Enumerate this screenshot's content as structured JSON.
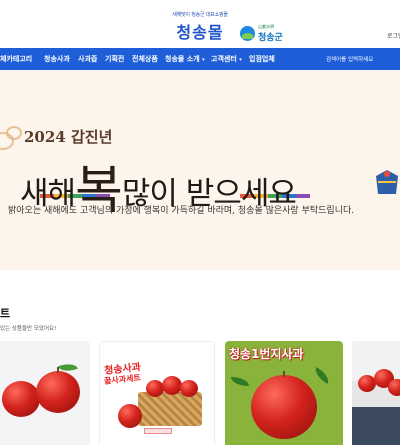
{
  "header": {
    "logo_sub": "새해맞이 청송군 대표쇼핑몰",
    "logo_main": "청송몰",
    "partner_small": "山紫水明",
    "partner_name": "청송군",
    "login_label": "로그인"
  },
  "nav": {
    "all_categories": "체카테고리",
    "items": [
      "청송사과",
      "사과즙",
      "기획전",
      "전체상품",
      "청송몰 소개",
      "고객센터",
      "입점업체"
    ],
    "right_text": "검색어를 입력하세요"
  },
  "banner": {
    "year": "2024 갑진년",
    "main_pre": "새해",
    "main_bok": "복",
    "main_post": "많이 받으세요",
    "subtitle": "밝아오는 새해에도 고객님의 가정에 행복이 가득하길 바라며, 청송몰 많은사랑 부탁드립니다.",
    "slide_count": 4,
    "active_slide": 0
  },
  "section": {
    "title": "트",
    "subtitle": "있는 상품들만 모았어요!"
  },
  "cards": [
    {
      "title": ""
    },
    {
      "title": "청송사과",
      "title2": "꿀사과세트"
    },
    {
      "title": "청송1번지사과"
    },
    {
      "title": ""
    }
  ],
  "colors": {
    "brand_blue": "#1e5ed8",
    "banner_bg": "#fdf5ec",
    "active_dot": "#1aa9a4"
  }
}
